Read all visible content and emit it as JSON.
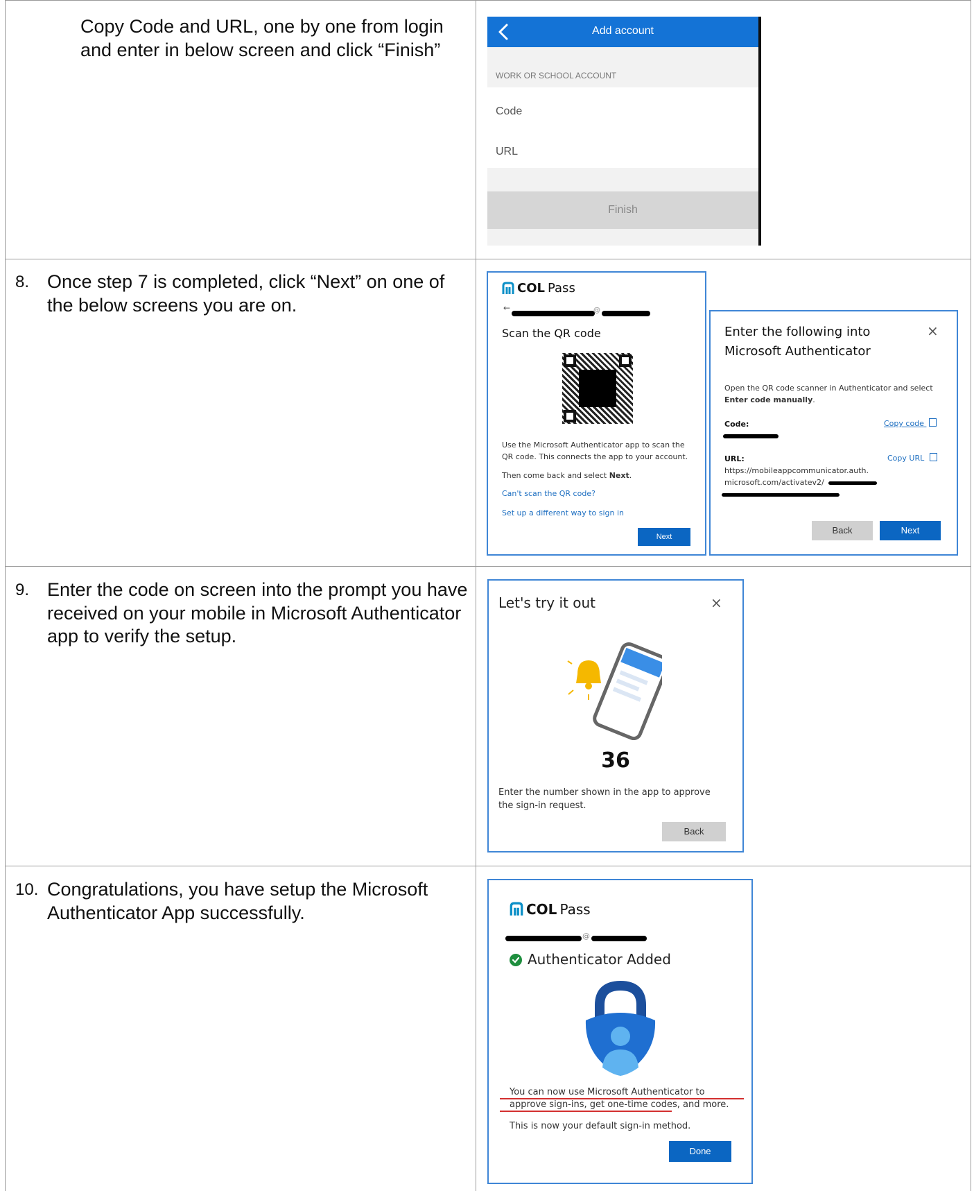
{
  "steps": [
    {
      "number": "",
      "text": "Copy Code and URL, one by one from login and enter in below screen and click “Finish”"
    },
    {
      "number": "8.",
      "text": "Once step 7 is completed, click “Next” on one of the below screens you are on."
    },
    {
      "number": "9.",
      "text": "Enter the code on screen into the prompt you have received on your mobile in Microsoft Authenticator app to verify the setup."
    },
    {
      "number": "10.",
      "text": "Congratulations, you have setup the Microsoft Authenticator App successfully."
    }
  ],
  "add_account": {
    "title": "Add account",
    "section": "WORK OR SCHOOL ACCOUNT",
    "code_placeholder": "Code",
    "url_placeholder": "URL",
    "finish": "Finish"
  },
  "brand": {
    "col": "COL",
    "pass": "Pass"
  },
  "qr_card": {
    "back_arrow": "←",
    "at": "@",
    "title": "Scan the QR code",
    "desc": "Use the Microsoft Authenticator app to scan the QR code. This connects the app to your account.",
    "then_prefix": "Then come back and select ",
    "then_bold": "Next",
    "then_suffix": ".",
    "cant_scan": "Can't scan the QR code?",
    "different_way": "Set up a different way to sign in",
    "next": "Next"
  },
  "manual_card": {
    "title": "Enter the following into Microsoft Authenticator",
    "close": "×",
    "desc_prefix": "Open the QR code scanner in Authenticator and select ",
    "desc_bold": "Enter code manually",
    "desc_suffix": ".",
    "code_label": "Code:",
    "copy_code": "Copy code",
    "url_label": "URL:",
    "copy_url": "Copy URL",
    "url_line1": "https://mobileappcommunicator.auth.",
    "url_line2": "microsoft.com/activatev2/",
    "back": "Back",
    "next": "Next"
  },
  "try_card": {
    "title": "Let's try it out",
    "close": "×",
    "number": "36",
    "desc": "Enter the number shown in the app to approve the sign-in request.",
    "back": "Back"
  },
  "added_card": {
    "at": "@",
    "title": "Authenticator Added",
    "desc": "You can now use Microsoft Authenticator to approve sign-ins, get one-time codes, and more.",
    "default_method": "This is now your default sign-in method.",
    "done": "Done"
  },
  "colors": {
    "accent": "#0b66c2",
    "card_border": "#3f86d6",
    "success": "#1e8e3e",
    "annotation": "#d32f2f"
  }
}
